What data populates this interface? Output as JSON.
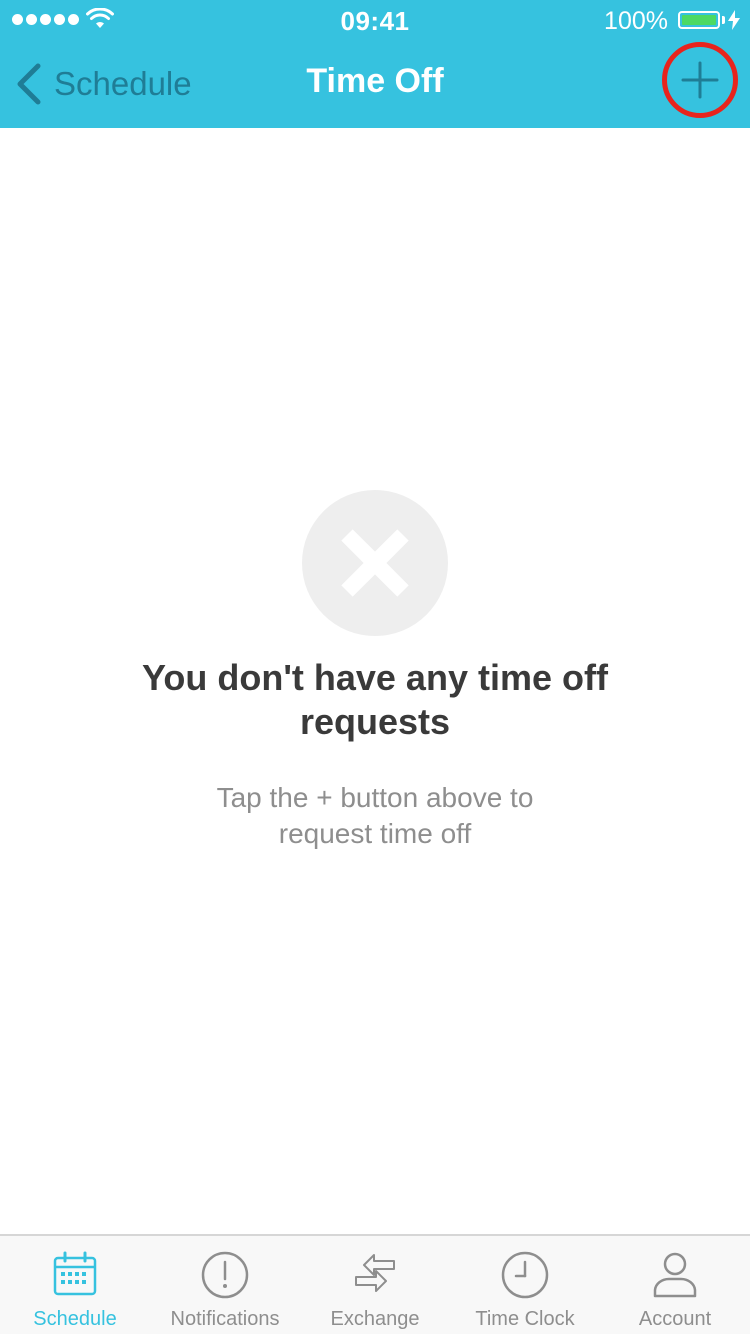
{
  "status_bar": {
    "time": "09:41",
    "battery_percent": "100%",
    "battery_level": 1.0,
    "signal_dots": 5
  },
  "nav": {
    "back_label": "Schedule",
    "title": "Time Off",
    "add_icon": "plus-icon"
  },
  "empty_state": {
    "icon": "x-icon",
    "title": "You don't have any time off requests",
    "subtitle": "Tap the + button above to request time off"
  },
  "tabs": [
    {
      "label": "Schedule",
      "icon": "calendar-icon",
      "active": true
    },
    {
      "label": "Notifications",
      "icon": "exclamation-icon",
      "active": false
    },
    {
      "label": "Exchange",
      "icon": "exchange-arrows-icon",
      "active": false
    },
    {
      "label": "Time Clock",
      "icon": "clock-icon",
      "active": false
    },
    {
      "label": "Account",
      "icon": "person-icon",
      "active": false
    }
  ],
  "colors": {
    "header_bg": "#36C2DF",
    "back_text": "#1F7D96",
    "highlight_ring": "#E8241D",
    "battery_fill": "#4CD964",
    "active_tab": "#36C2DF",
    "inactive_tab": "#8E8E8E"
  }
}
